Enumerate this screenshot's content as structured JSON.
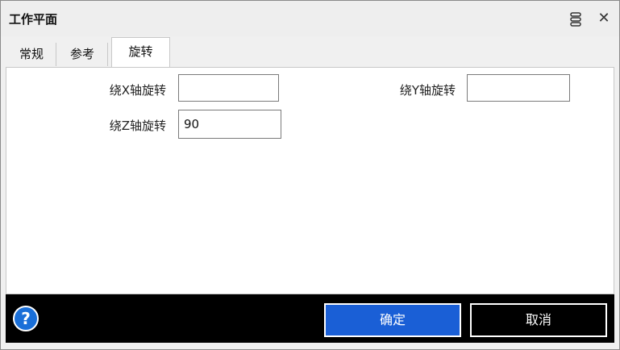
{
  "window": {
    "title": "工作平面"
  },
  "tabs": [
    {
      "label": "常规"
    },
    {
      "label": "参考"
    },
    {
      "label": "旋转",
      "active": true
    }
  ],
  "form": {
    "rot_x_label": "绕X轴旋转",
    "rot_x_value": "",
    "rot_y_label": "绕Y轴旋转",
    "rot_y_value": "",
    "rot_z_label": "绕Z轴旋转",
    "rot_z_value": "90"
  },
  "footer": {
    "help_symbol": "?",
    "ok_label": "确定",
    "cancel_label": "取消"
  },
  "icons": {
    "close": "close-icon",
    "menu": "menu-icon",
    "help": "help-icon"
  },
  "colors": {
    "accent": "#1a5fd6",
    "footer_bg": "#000000"
  }
}
